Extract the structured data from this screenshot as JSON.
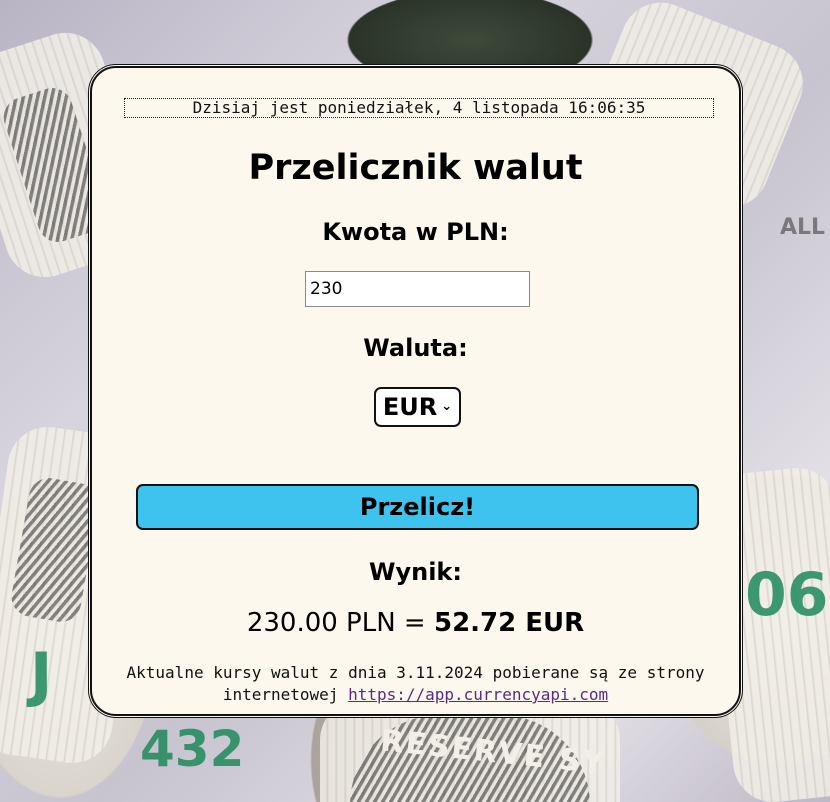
{
  "background": {
    "description_icons": "money-rolls-background",
    "numbers": [
      "06",
      "J",
      "432",
      "ALL"
    ],
    "text_marks": [
      "RESERVE SY"
    ]
  },
  "header": {
    "datetime": "Dzisiaj jest poniedziałek, 4 listopada 16:06:35"
  },
  "main": {
    "title": "Przelicznik walut",
    "amount_label": "Kwota w PLN:",
    "amount_value": "230",
    "currency_label": "Waluta:",
    "currency_selected": "EUR",
    "convert_button": "Przelicz!",
    "result_label": "Wynik:",
    "result_prefix": "230.00 PLN = ",
    "result_value": "52.72 EUR"
  },
  "footer": {
    "text": "Aktualne kursy walut z dnia 3.11.2024 pobierane są ze strony internetowej ",
    "link_text": "https://app.currencyapi.com"
  },
  "colors": {
    "card_bg": "#fdf8ee",
    "button_bg": "#3ec3ef",
    "link": "#5b2a86"
  }
}
